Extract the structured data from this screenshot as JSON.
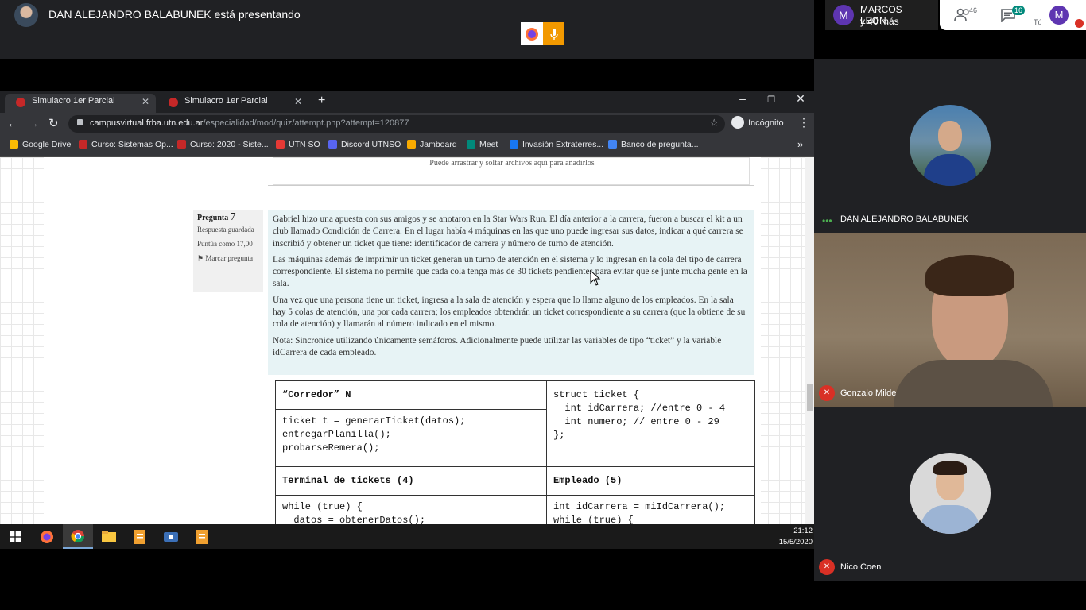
{
  "meet": {
    "presenter_text": "DAN ALEJANDRO BALABUNEK está presentando",
    "people_panel": {
      "avatar_letter": "M",
      "name": "MARCOS LEON...",
      "more": "y 40 más"
    },
    "participants_count": "46",
    "chat_count": "16",
    "self_letter": "M",
    "self_label": "Tú",
    "participants": [
      {
        "name": "DAN ALEJANDRO BALABUNEK"
      },
      {
        "name": "Gonzalo Milde"
      },
      {
        "name": "Nico Coen"
      }
    ]
  },
  "browser": {
    "tabs": [
      {
        "label": "Simulacro 1er Parcial"
      },
      {
        "label": "Simulacro 1er Parcial"
      }
    ],
    "url_host": "campusvirtual.frba.utn.edu.ar",
    "url_path": "/especialidad/mod/quiz/attempt.php?attempt=120877",
    "incognito": "Incógnito",
    "bookmarks": [
      {
        "label": "Google Drive",
        "color": "#fbbc04"
      },
      {
        "label": "Curso: Sistemas Op...",
        "color": "#c62828"
      },
      {
        "label": "Curso: 2020 - Siste...",
        "color": "#c62828"
      },
      {
        "label": "UTN SO",
        "color": "#e53935"
      },
      {
        "label": "Discord UTNSO",
        "color": "#5865f2"
      },
      {
        "label": "Jamboard",
        "color": "#f9ab00"
      },
      {
        "label": "Meet",
        "color": "#00897b"
      },
      {
        "label": "Invasión Extraterres...",
        "color": "#1877f2"
      },
      {
        "label": "Banco de pregunta...",
        "color": "#4285f4"
      }
    ]
  },
  "quiz": {
    "drop_text": "Puede arrastrar y soltar archivos aquí para añadirlos",
    "question_label": "Pregunta",
    "question_number": "7",
    "status": "Respuesta guardada",
    "score": "Puntúa como 17,00",
    "flag": "Marcar pregunta",
    "paragraphs": [
      "Gabriel hizo una apuesta con sus amigos y se anotaron en la Star Wars Run. El día anterior a la carrera, fueron a buscar el kit a un club llamado Condición de Carrera. En el lugar había 4 máquinas en las que uno puede ingresar sus datos, indicar a qué carrera se inscribió y obtener un ticket que tiene: identificador de carrera y número de turno de atención.",
      "Las máquinas además de imprimir un ticket generan un turno de atención en el sistema y lo ingresan en la cola del tipo de carrera correspondiente. El sistema no permite que cada cola tenga más de 30 tickets pendientes para evitar que se junte mucha gente en la sala.",
      "Una vez que una persona tiene un ticket, ingresa a la sala de atención y espera que lo llame alguno de los empleados. En la sala hay 5 colas de atención, una por cada carrera; los empleados obtendrán un ticket correspondiente a su carrera (que la obtiene de su cola de atención) y llamarán al número indicado en el mismo.",
      "Nota: Sincronice utilizando únicamente semáforos. Adicionalmente puede utilizar las variables de tipo “ticket” y la variable  idCarrera de cada empleado."
    ],
    "code": {
      "runner_header": "“Corredor” N",
      "runner_code": "ticket t = generarTicket(datos);\nentregarPlanilla();\nprobarseRemera();",
      "struct_code": "struct ticket {\n  int idCarrera; //entre 0 - 4\n  int numero; // entre 0 - 29\n};",
      "terminal_header": "Terminal de tickets (4)",
      "terminal_code": "while (true) {\n  datos = obtenerDatos();",
      "employee_header": "Empleado (5)",
      "employee_code": "int idCarrera = miIdCarrera();\nwhile (true) {"
    }
  },
  "taskbar": {
    "time": "21:12",
    "date": "15/5/2020"
  }
}
